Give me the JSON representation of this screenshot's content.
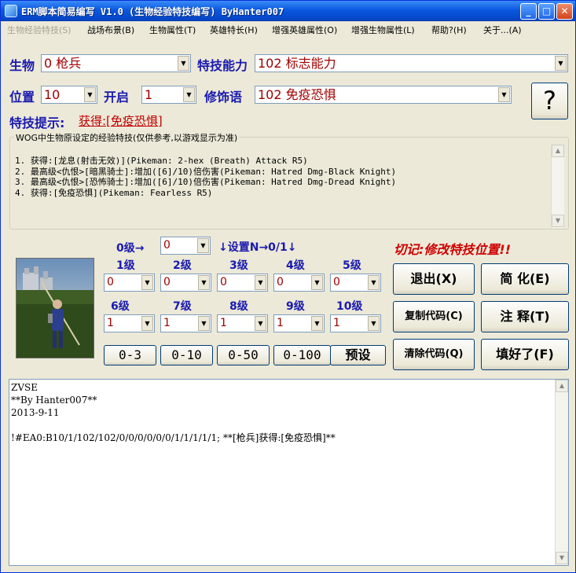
{
  "window": {
    "title": "ERM脚本简易编写 V1.0 (生物经验特技编写) ByHanter007",
    "minimize": "_",
    "maximize": "□",
    "close": "✕"
  },
  "menu": [
    {
      "label": "生物经验特技(S)",
      "disabled": true
    },
    {
      "label": "战场布景(B)"
    },
    {
      "label": "生物属性(T)"
    },
    {
      "label": "英雄特长(H)"
    },
    {
      "label": "增强英雄属性(O)"
    },
    {
      "label": "增强生物属性(L)"
    },
    {
      "label": "帮助?(H)"
    },
    {
      "label": "关于...(A)"
    }
  ],
  "form": {
    "creature_label": "生物",
    "creature_value": "0 枪兵",
    "ability_label": "特技能力",
    "ability_value": "102 标志能力",
    "position_label": "位置",
    "position_value": "10",
    "enable_label": "开启",
    "enable_value": "1",
    "modifier_label": "修饰语",
    "modifier_value": "102 免疫恐惧",
    "hint_label": "特技提示:",
    "hint_value": "获得:[免疫恐惧]",
    "help_button": "?"
  },
  "info_group": {
    "title": "WOG中生物原设定的经验特技(仅供参考,以游戏显示为准)",
    "lines": [
      "1. 获得:[龙息(射击无效)](Pikeman: 2-hex (Breath) Attack R5)",
      "2. 最高级<仇恨>[暗黑骑士]:增加([6]/10)倍伤害(Pikeman: Hatred Dmg-Black Knight)",
      "3. 最高级<仇恨>[恐怖骑士]:增加([6]/10)倍伤害(Pikeman: Hatred Dmg-Dread Knight)",
      "4. 获得:[免疫恐惧](Pikeman: Fearless R5)"
    ]
  },
  "levels": {
    "level0_label": "0级→",
    "level0_value": "0",
    "set_note": "↓设置N→0/1↓",
    "warning": "切记:修改特技位置!!",
    "row1_labels": [
      "1级",
      "2级",
      "3级",
      "4级",
      "5级"
    ],
    "row1_values": [
      "0",
      "0",
      "0",
      "0",
      "0"
    ],
    "row2_labels": [
      "6级",
      "7级",
      "8级",
      "9级",
      "10级"
    ],
    "row2_values": [
      "1",
      "1",
      "1",
      "1",
      "1"
    ],
    "presets": [
      "0-3",
      "0-10",
      "0-50",
      "0-100",
      "预设"
    ]
  },
  "buttons": {
    "exit": "退出(X)",
    "simplify": "简 化(E)",
    "copy": "复制代码(C)",
    "comment": "注 释(T)",
    "clear": "清除代码(Q)",
    "done": "填好了(F)"
  },
  "code": {
    "lines": [
      "ZVSE",
      "**By Hanter007**",
      "2013-9-11",
      "",
      "!#EA0:B10/1/102/102/0/0/0/0/0/0/1/1/1/1/1; **[枪兵]获得:[免疫恐惧]**"
    ]
  },
  "icons": {
    "app": "app-icon",
    "dropdown": "chevron-down-icon",
    "hero": "pikeman-portrait"
  }
}
